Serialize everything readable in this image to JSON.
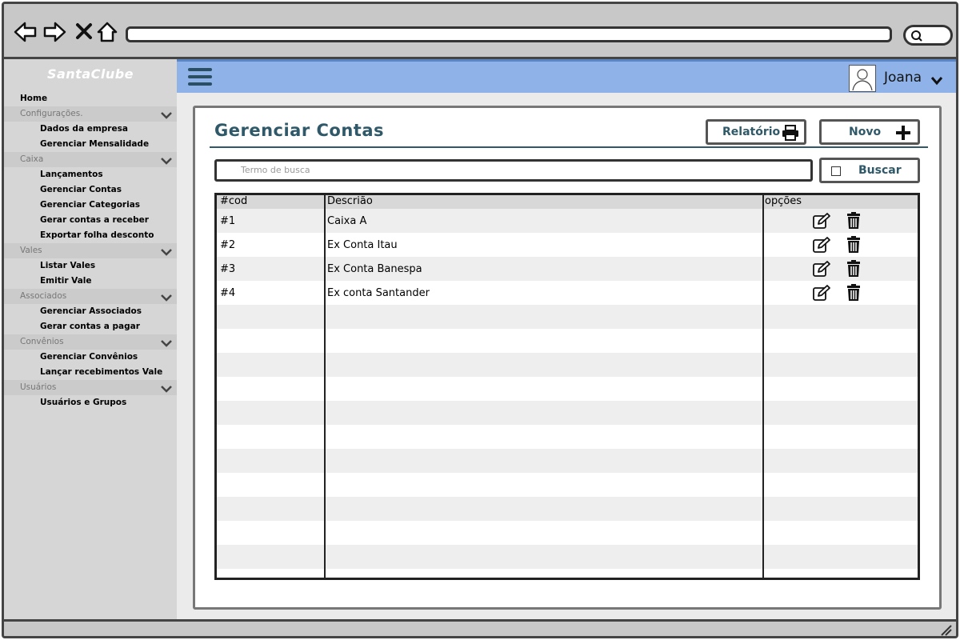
{
  "browser": {
    "icons": [
      "back-arrow-icon",
      "forward-arrow-icon",
      "close-icon",
      "home-icon",
      "search-icon"
    ],
    "url": ""
  },
  "sidebar": {
    "brand": "SantaClube",
    "items": [
      {
        "label": "Home",
        "type": "item"
      },
      {
        "label": "Configurações.",
        "type": "group"
      },
      {
        "label": "Dados da empresa",
        "type": "sub"
      },
      {
        "label": "Gerenciar Mensalidade",
        "type": "sub"
      },
      {
        "label": "Caixa",
        "type": "group"
      },
      {
        "label": "Lançamentos",
        "type": "sub"
      },
      {
        "label": "Gerenciar Contas",
        "type": "sub"
      },
      {
        "label": "Gerenciar Categorias",
        "type": "sub"
      },
      {
        "label": "Gerar contas a receber",
        "type": "sub"
      },
      {
        "label": "Exportar folha desconto",
        "type": "sub"
      },
      {
        "label": "Vales",
        "type": "group"
      },
      {
        "label": "Listar Vales",
        "type": "sub"
      },
      {
        "label": "Emitir Vale",
        "type": "sub"
      },
      {
        "label": "Associados",
        "type": "group"
      },
      {
        "label": "Gerenciar Associados",
        "type": "sub"
      },
      {
        "label": "Gerar contas a pagar",
        "type": "sub"
      },
      {
        "label": "Convênios",
        "type": "group"
      },
      {
        "label": "Gerenciar Convênios",
        "type": "sub"
      },
      {
        "label": "Lançar recebimentos Vale",
        "type": "sub"
      },
      {
        "label": "Usuários",
        "type": "group"
      },
      {
        "label": "Usuários e Grupos",
        "type": "sub"
      }
    ]
  },
  "header": {
    "user_name": "Joana"
  },
  "main": {
    "title": "Gerenciar Contas",
    "report_label": "Relatório",
    "new_label": "Novo",
    "search": {
      "placeholder": "Termo de busca",
      "button_label": "Buscar"
    },
    "table": {
      "columns": [
        "#cod",
        "Descrião",
        "opções"
      ],
      "rows": [
        {
          "cod": "#1",
          "desc": "Caixa A"
        },
        {
          "cod": "#2",
          "desc": "Ex Conta Itau"
        },
        {
          "cod": "#3",
          "desc": "Ex Conta Banespa"
        },
        {
          "cod": "#4",
          "desc": "Ex conta Santander"
        }
      ]
    }
  },
  "colors": {
    "accent": "#2f5868",
    "topbar": "#8fb3e8",
    "sidebar": "#d6d6d6"
  }
}
